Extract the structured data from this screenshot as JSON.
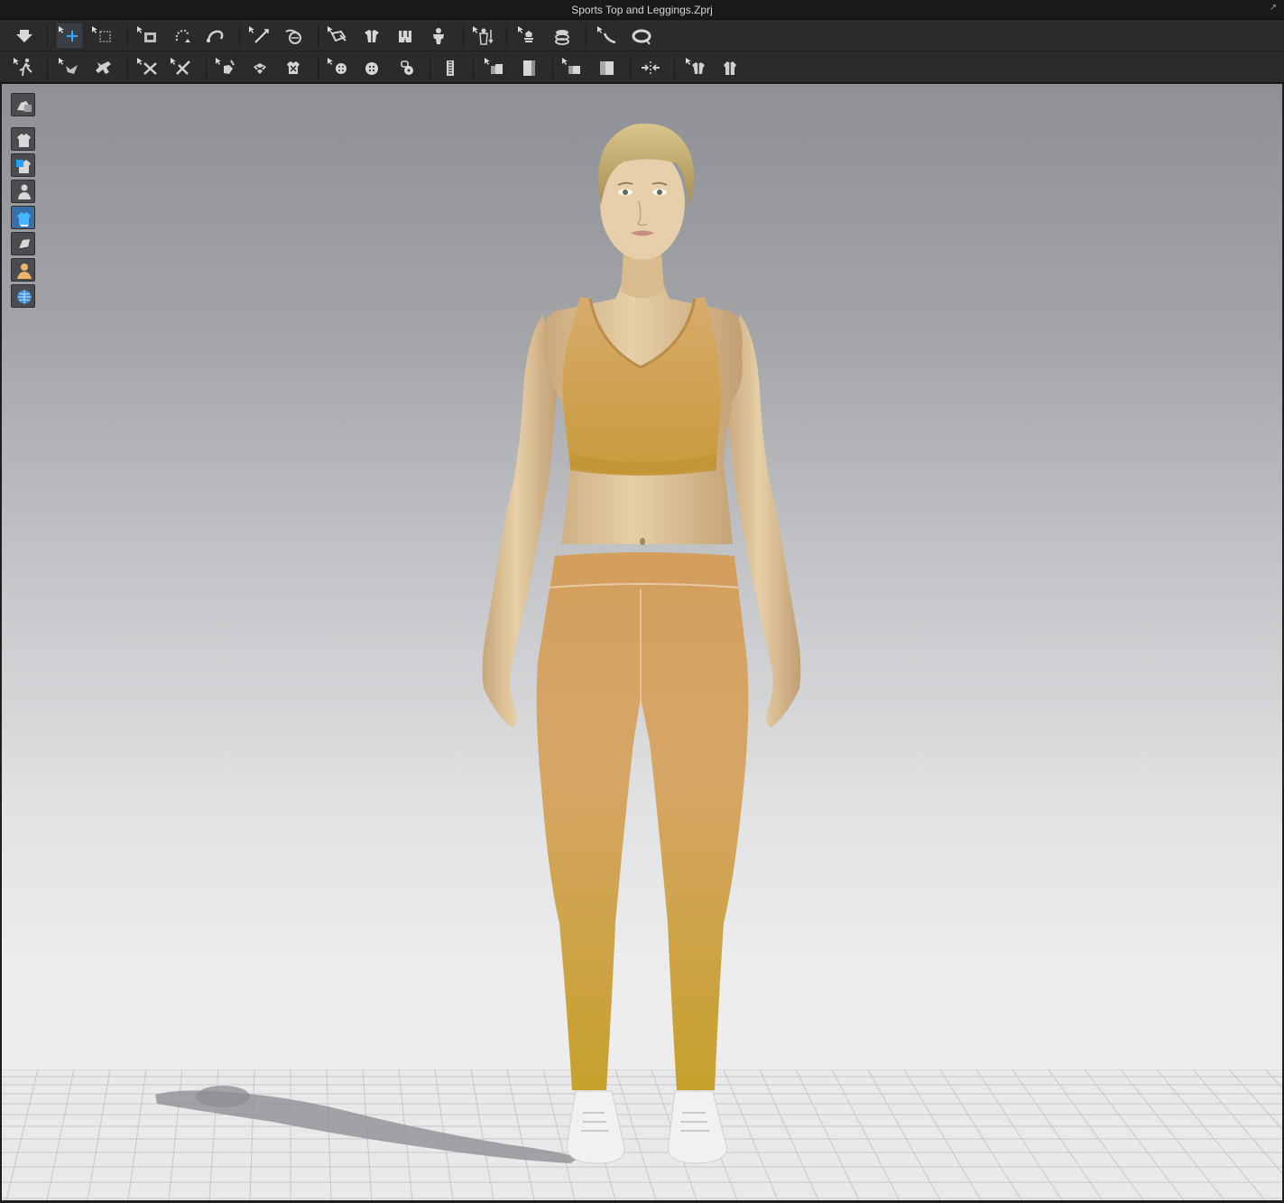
{
  "window": {
    "title": "Sports Top and Leggings.Zprj"
  },
  "toolbar_row1": {
    "tools": [
      "simulation-icon",
      "select-move-icon",
      "select-mesh-box-icon",
      "transform-pattern-icon",
      "transform-mesh-icon",
      "edit-curvature-icon",
      "segment-sewing-icon",
      "free-sewing-icon",
      "edit-sewing-icon",
      "fold-arrangement-icon",
      "show-arrangement-points-icon",
      "hide-avatar-icon",
      "avatar-pose-icon",
      "fabric-style-icon",
      "strengthen-icon",
      "layer-icon",
      "tack-icon",
      "pin-icon"
    ]
  },
  "toolbar_row2": {
    "tools": [
      "animation-walk-icon",
      "fold-icon",
      "tack-on-avatar-icon",
      "edit-texture-icon",
      "edit-graphic-icon",
      "bond-icon",
      "puckering-icon",
      "topstitch-icon",
      "button-icon",
      "buttonhole-icon",
      "gathering-icon",
      "zipper-icon",
      "fold-pattern-icon",
      "piping-icon",
      "elastic-icon",
      "shrinkage-icon",
      "measure-circumference-icon",
      "measure-length-icon",
      "garment-fit-map-icon"
    ]
  },
  "view_tools": {
    "items": [
      "camera-view-icon",
      "show-garment-icon",
      "show-avatar-skin-icon",
      "show-avatar-icon",
      "show-3d-garment-icon",
      "texture-view-icon",
      "avatar-display-icon",
      "environment-globe-icon"
    ]
  },
  "colors": {
    "accent": "#1da1ff",
    "garment": "#c9a052",
    "background_top": "#8e9095",
    "background_bottom": "#eeeeef"
  }
}
